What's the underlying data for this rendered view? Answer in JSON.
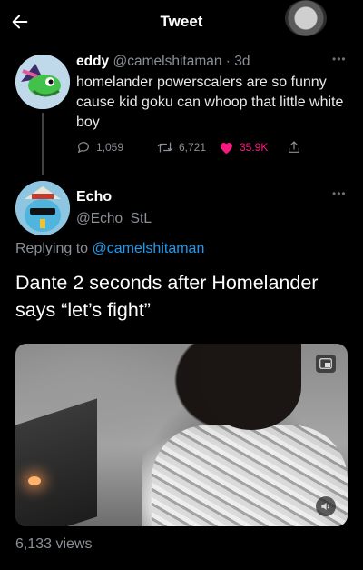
{
  "header": {
    "title": "Tweet"
  },
  "original_tweet": {
    "display_name": "eddy",
    "handle": "@camelshitaman",
    "time": "· 3d",
    "text": "homelander powerscalers are so funny cause kid goku can whoop that little white boy",
    "replies": "1,059",
    "retweets": "6,721",
    "likes": "35.9K",
    "liked": true,
    "like_color": "#f91880"
  },
  "reply_tweet": {
    "display_name": "Echo",
    "handle": "@Echo_StL",
    "replying_label": "Replying to",
    "replying_to": "@camelshitaman",
    "text": "Dante 2 seconds after Homelander says “let’s fight”",
    "views": "6,133 views"
  },
  "colors": {
    "background": "#000000",
    "link": "#1d9bf0",
    "muted": "#8b9096"
  },
  "icons": [
    "back-arrow-icon",
    "more-icon",
    "reply-icon",
    "retweet-icon",
    "heart-icon",
    "share-icon",
    "gif-icon",
    "volume-icon"
  ]
}
